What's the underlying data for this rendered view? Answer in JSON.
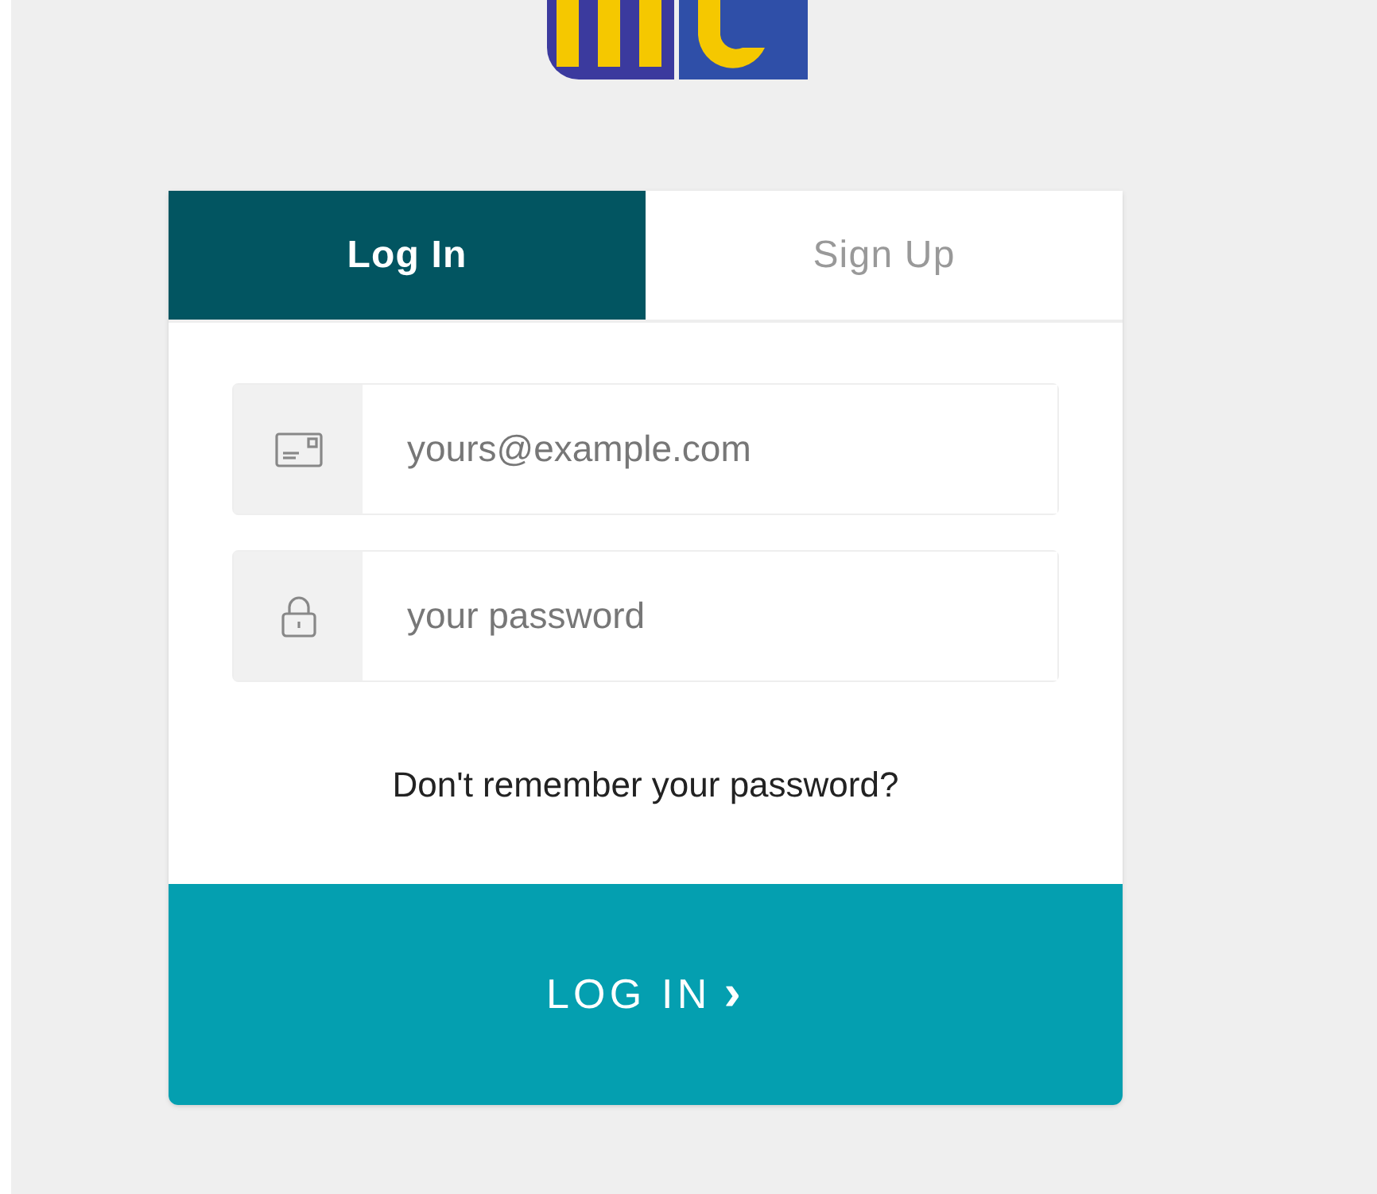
{
  "tabs": [
    {
      "label": "Log In",
      "selected": true
    },
    {
      "label": "Sign Up",
      "selected": false
    }
  ],
  "fields": [
    {
      "kind": "email",
      "placeholder": "yours@example.com"
    },
    {
      "kind": "password",
      "placeholder": "your password"
    }
  ],
  "forgot_link": "Don't remember your password?",
  "submit": {
    "label": "LOG IN",
    "icon": "›"
  }
}
